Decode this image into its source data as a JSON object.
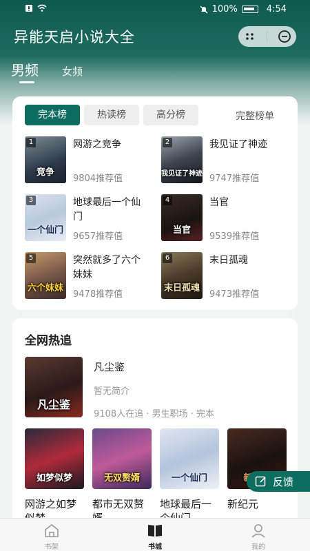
{
  "status": {
    "battery": "100%",
    "time": "4:54"
  },
  "app": {
    "title": "异能天启小说大全"
  },
  "gender_tabs": [
    {
      "label": "男频",
      "active": true
    },
    {
      "label": "女频",
      "active": false
    }
  ],
  "rank": {
    "tabs": [
      "完本榜",
      "热读榜",
      "高分榜"
    ],
    "active_tab": "完本榜",
    "more_label": "完整榜单",
    "books": [
      {
        "rank": "1",
        "name": "网游之竞争",
        "rec": "9804推荐值",
        "cover_text": "竞争"
      },
      {
        "rank": "2",
        "name": "我见证了神迹",
        "rec": "9747推荐值",
        "cover_text": "我见证了神迹"
      },
      {
        "rank": "3",
        "name": "地球最后一个仙门",
        "rec": "9657推荐值",
        "cover_text": "一个仙门"
      },
      {
        "rank": "4",
        "name": "当官",
        "rec": "9539推荐值",
        "cover_text": "当官"
      },
      {
        "rank": "5",
        "name": "突然就多了六个妹妹",
        "rec": "9478推荐值",
        "cover_text": "六个妹妹"
      },
      {
        "rank": "6",
        "name": "末日孤魂",
        "rec": "9473推荐值",
        "cover_text": "末日孤魂"
      }
    ]
  },
  "hot": {
    "title": "全网热追",
    "featured": {
      "name": "凡尘鉴",
      "intro": "暂无简介",
      "meta": "9108人在追 · 男生职场 · 完本",
      "cover_text": "凡尘鉴"
    },
    "books": [
      {
        "name": "网游之如梦似梦",
        "cover_text": "如梦似梦"
      },
      {
        "name": "都市无双赘婿",
        "cover_text": "无双赘婿"
      },
      {
        "name": "地球最后一个仙门",
        "cover_text": "一个仙门"
      },
      {
        "name": "新纪元",
        "cover_text": "新纪元"
      }
    ]
  },
  "feedback": {
    "label": "反馈"
  },
  "nav": [
    {
      "label": "书架",
      "icon": "home-icon",
      "active": false
    },
    {
      "label": "书城",
      "icon": "book-icon",
      "active": true
    },
    {
      "label": "我的",
      "icon": "profile-icon",
      "active": false
    }
  ],
  "colors": {
    "primary": "#0d6e5f",
    "header": "#0f5a4f"
  }
}
